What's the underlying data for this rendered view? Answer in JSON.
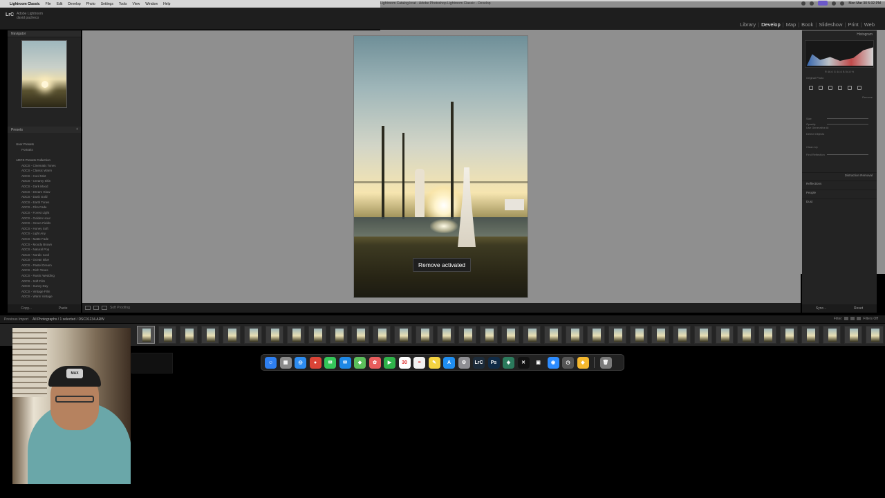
{
  "menubar": {
    "app_name": "Lightroom Classic",
    "menus": [
      "File",
      "Edit",
      "Develop",
      "Photo",
      "Settings",
      "Tools",
      "View",
      "Window",
      "Help"
    ],
    "window_title": "Lightroom Catalog.lrcat - Adobe Photoshop Lightroom Classic - Develop",
    "clock": "Mon Mar 30  5:32 PM"
  },
  "lr": {
    "logo": "LrC",
    "identity_line1": "Adobe Lightroom",
    "identity_line2": "david pacheco",
    "modules": [
      "Library",
      "Develop",
      "Map",
      "Book",
      "Slideshow",
      "Print",
      "Web"
    ],
    "active_module": "Develop"
  },
  "left_panel": {
    "navigator_title": "Navigator",
    "presets_title": "Presets",
    "preset_groups": [
      "User Presets",
      "ADCS Presets Collection"
    ],
    "user_presets": [
      "Portraits"
    ],
    "presets": [
      "ADCS - Cinematic Tones",
      "ADCS - Classic Warm",
      "ADCS - Cool Mist",
      "ADCS - Creamy Skin",
      "ADCS - Dark Mood",
      "ADCS - Dream Glow",
      "ADCS - Dusk Gold",
      "ADCS - Earth Tones",
      "ADCS - Film Fade",
      "ADCS - Forest Light",
      "ADCS - Golden Hour",
      "ADCS - Green Fields",
      "ADCS - Honey Soft",
      "ADCS - Light Airy",
      "ADCS - Matte Fade",
      "ADCS - Moody Brown",
      "ADCS - Natural Pop",
      "ADCS - Nordic Cool",
      "ADCS - Ocean Blue",
      "ADCS - Pastel Dream",
      "ADCS - Rich Tones",
      "ADCS - Rustic Wedding",
      "ADCS - Soft Film",
      "ADCS - Sunny Day",
      "ADCS - Vintage Film",
      "ADCS - Warm Vintage"
    ],
    "copy_label": "Copy...",
    "paste_label": "Paste"
  },
  "center": {
    "toast": "Remove activated",
    "softproof_label": "Soft Proofing"
  },
  "right_panel": {
    "histogram_title": "Histogram",
    "histogram_info": "R 46.6  G 44.6  B 54.8 %",
    "original_photo_label": "Original Photo",
    "remove_label": "Remove",
    "rows": [
      "Size",
      "Opacity",
      "Use Generative AI",
      "Detect Objects",
      "Clean Up",
      "Find Reflection"
    ],
    "sections": [
      "Distraction Removal",
      "Reflections",
      "People",
      "Dust"
    ],
    "sync_label": "Sync...",
    "reset_label": "Reset"
  },
  "filmbar": {
    "view_label": "Previous Import",
    "path": "All Photographs / 1 selected / DSC01234.ARW",
    "filter_label": "Filter:",
    "filter_value": "Filters Off"
  },
  "filmstrip": {
    "thumb_count": 35,
    "selected_index": 0
  },
  "dock": {
    "apps": [
      {
        "name": "finder",
        "color": "#2e7ff0",
        "glyph": "☺"
      },
      {
        "name": "launchpad",
        "color": "#8a8a8a",
        "glyph": "▦"
      },
      {
        "name": "safari",
        "color": "#2d8cf0",
        "glyph": "◎"
      },
      {
        "name": "chrome",
        "color": "#db4437",
        "glyph": "●"
      },
      {
        "name": "messages",
        "color": "#34c759",
        "glyph": "✉"
      },
      {
        "name": "mail",
        "color": "#1e88e5",
        "glyph": "✉"
      },
      {
        "name": "maps",
        "color": "#5bbf5b",
        "glyph": "◆"
      },
      {
        "name": "photos",
        "color": "#e85d5d",
        "glyph": "✿"
      },
      {
        "name": "facetime",
        "color": "#2fb34a",
        "glyph": "▶"
      },
      {
        "name": "calendar",
        "color": "#ffffff",
        "glyph": "30"
      },
      {
        "name": "reminders",
        "color": "#f2f2f2",
        "glyph": "≡"
      },
      {
        "name": "notes",
        "color": "#f5d442",
        "glyph": "✎"
      },
      {
        "name": "app-store",
        "color": "#1f8ef1",
        "glyph": "A"
      },
      {
        "name": "system-settings",
        "color": "#8e8e93",
        "glyph": "⚙"
      },
      {
        "name": "lightroom-classic",
        "color": "#1c2b3a",
        "glyph": "LrC"
      },
      {
        "name": "photoshop",
        "color": "#0f2a46",
        "glyph": "Ps"
      },
      {
        "name": "pixelmator",
        "color": "#2b7a5c",
        "glyph": "◈"
      },
      {
        "name": "capcut",
        "color": "#111111",
        "glyph": "✕"
      },
      {
        "name": "final-cut",
        "color": "#222222",
        "glyph": "▣"
      },
      {
        "name": "zoom",
        "color": "#2d8cff",
        "glyph": "◉"
      },
      {
        "name": "time-machine",
        "color": "#555555",
        "glyph": "◷"
      },
      {
        "name": "sketch",
        "color": "#f5b82e",
        "glyph": "◆"
      },
      {
        "name": "trash",
        "color": "#7a7a7a",
        "glyph": "🗑"
      }
    ]
  },
  "webcam": {
    "cap_text": "MAX"
  }
}
